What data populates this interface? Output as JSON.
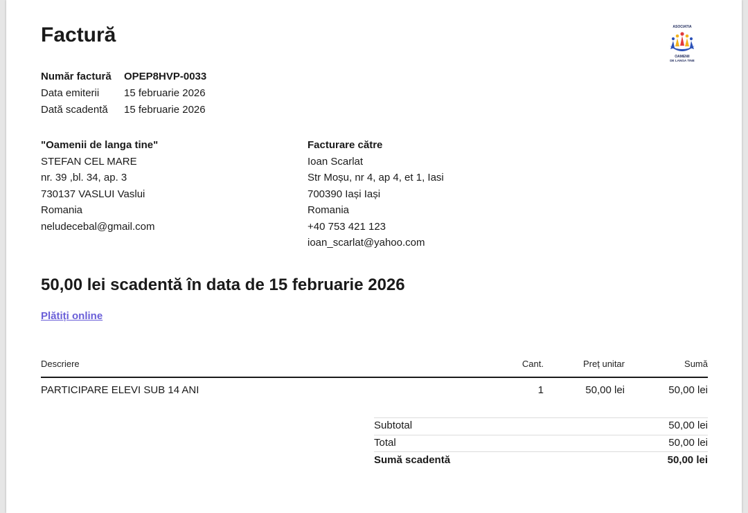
{
  "invoice": {
    "title": "Factură",
    "meta": [
      {
        "label": "Număr factură",
        "value": "OPEP8HVP-0033"
      },
      {
        "label": "Data emiterii",
        "value": "15 februarie 2026"
      },
      {
        "label": "Dată scadentă",
        "value": "15 februarie 2026"
      }
    ],
    "seller": {
      "name": "\"Oamenii de langa tine\"",
      "lines": [
        "STEFAN CEL MARE",
        "nr. 39 ,bl. 34, ap. 3",
        "730137 VASLUI Vaslui",
        "Romania",
        "neludecebal@gmail.com"
      ]
    },
    "billing": {
      "heading": "Facturare către",
      "lines": [
        "Ioan Scarlat",
        "Str Moșu, nr 4, ap 4, et 1, Iasi",
        "700390 Iași Iași",
        "Romania",
        "+40 753 421 123",
        "ioan_scarlat@yahoo.com"
      ]
    },
    "due_summary": "50,00 lei scadentă în data de 15 februarie 2026",
    "pay_link": "Plătiți online",
    "table": {
      "headers": {
        "description": "Descriere",
        "qty": "Cant.",
        "unit_price": "Preț unitar",
        "amount": "Sumă"
      },
      "rows": [
        {
          "description": "PARTICIPARE ELEVI SUB 14 ANI",
          "qty": "1",
          "unit_price": "50,00 lei",
          "amount": "50,00 lei"
        }
      ]
    },
    "totals": [
      {
        "label": "Subtotal",
        "value": "50,00 lei"
      },
      {
        "label": "Total",
        "value": "50,00 lei"
      },
      {
        "label": "Sumă scadentă",
        "value": "50,00 lei"
      }
    ]
  },
  "logo": {
    "top_text": "ASOCIATIA",
    "bottom_text_1": "OAMENII",
    "bottom_text_2": "DE LANGA TINE",
    "colors": {
      "blue": "#2c52b8",
      "red": "#e23b3b",
      "yellow": "#f2b21c",
      "navy": "#1f2a5c"
    }
  }
}
